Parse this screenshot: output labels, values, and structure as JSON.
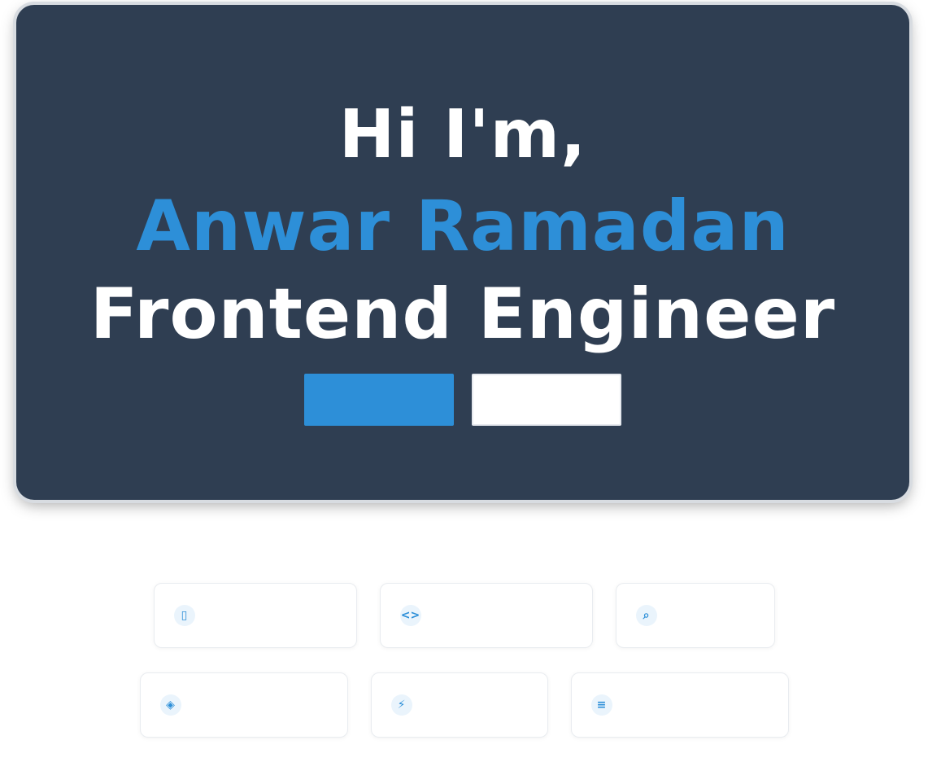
{
  "hero": {
    "greeting": "Hi I'm,",
    "name": "Anwar Ramadan",
    "role": "Frontend Engineer",
    "primary_button": "",
    "secondary_button": ""
  },
  "colors": {
    "accent": "#2d8fd8",
    "hero_bg": "#2f3e52"
  },
  "skills": {
    "row1": [
      {
        "icon": "mobile-icon",
        "label": ""
      },
      {
        "icon": "code-icon",
        "label": ""
      },
      {
        "icon": "search-icon",
        "label": ""
      }
    ],
    "row2": [
      {
        "icon": "shield-icon",
        "label": ""
      },
      {
        "icon": "bolt-icon",
        "label": ""
      },
      {
        "icon": "layers-icon",
        "label": ""
      }
    ]
  }
}
